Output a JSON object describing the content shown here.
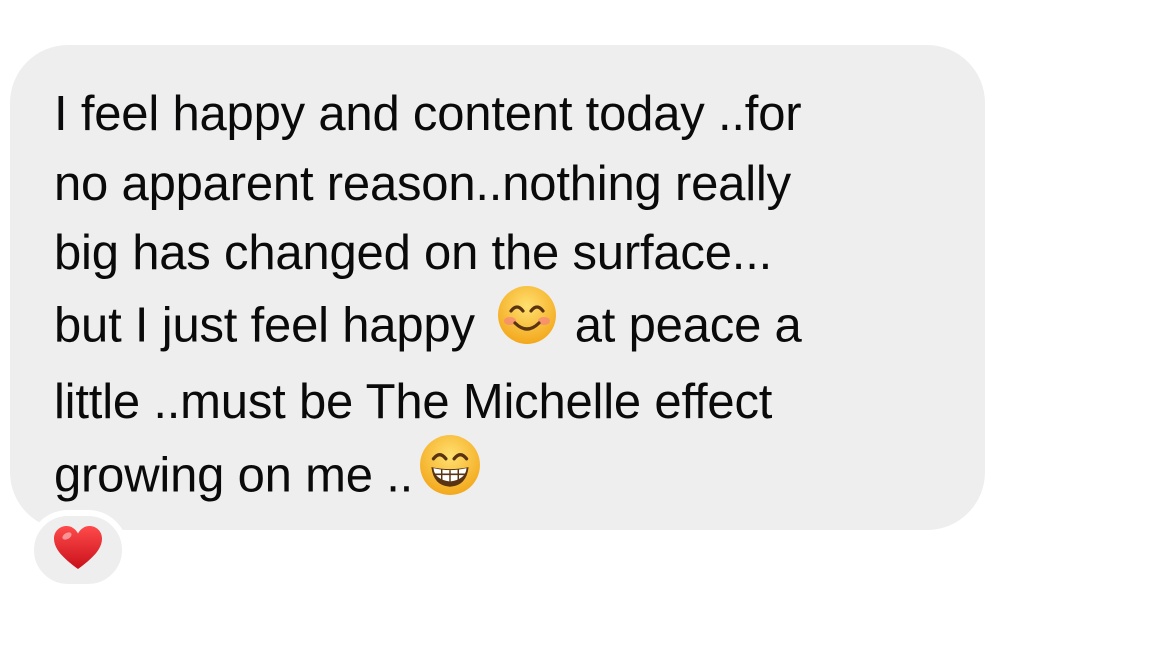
{
  "message": {
    "lines": [
      "I feel happy and content today ..for",
      "no apparent reason..nothing really",
      "big has changed on the surface...",
      "but I just feel happy",
      "at peace a",
      "little ..must be The Michelle effect",
      "growing on me .."
    ],
    "emoji_1": "smiling-face-with-smiling-eyes-icon",
    "emoji_2": "beaming-face-with-smiling-eyes-icon"
  },
  "reaction": {
    "icon": "red-heart-icon"
  },
  "colors": {
    "bubble": "#eeeeef",
    "text": "#0a0a0a",
    "background": "#ffffff",
    "heart": "#e0181f",
    "emoji_yellow": "#f7c233"
  }
}
